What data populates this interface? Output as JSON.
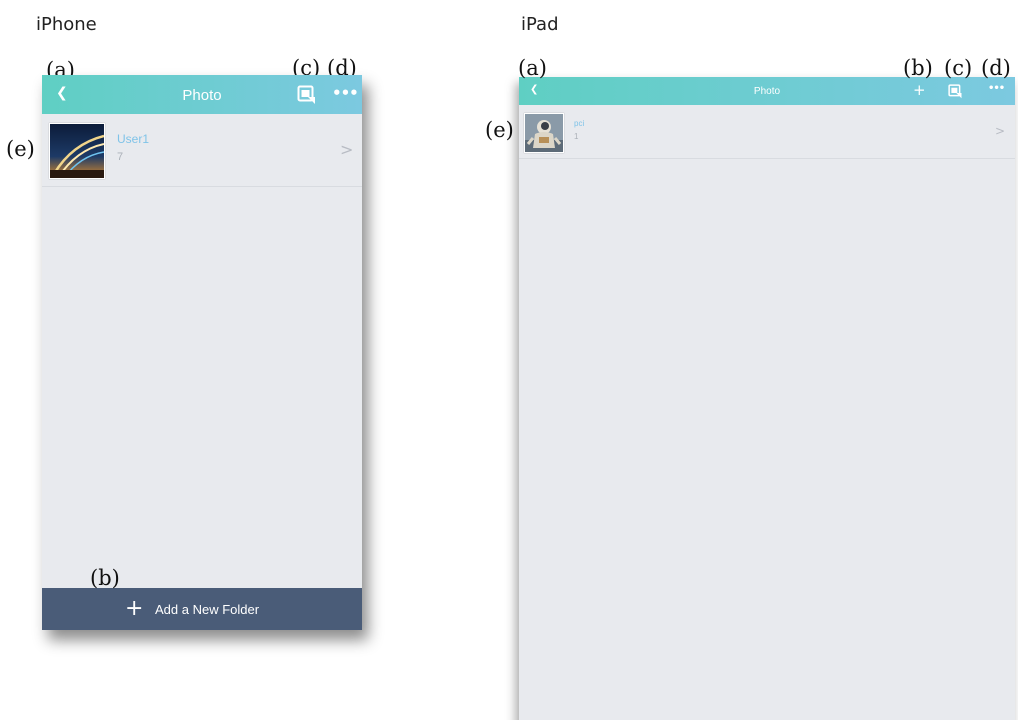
{
  "labels": {
    "iphone": "iPhone",
    "ipad": "iPad"
  },
  "callouts": {
    "a": "(a)",
    "b": "(b)",
    "c": "(c)",
    "d": "(d)",
    "e": "(e)"
  },
  "iphone": {
    "nav": {
      "back_icon": "chevron-left-icon",
      "title": "Photo",
      "share_icon": "share-photo-icon",
      "more_icon": "ellipsis-icon"
    },
    "folders": [
      {
        "name": "User1",
        "count": "7",
        "chevron": ">"
      }
    ],
    "bottom_bar": {
      "icon": "plus-icon",
      "label": "Add a New Folder"
    }
  },
  "ipad": {
    "nav": {
      "back_icon": "chevron-left-icon",
      "title": "Photo",
      "add_icon": "plus-icon",
      "share_icon": "share-photo-icon",
      "more_icon": "ellipsis-icon"
    },
    "folders": [
      {
        "name": "pci",
        "count": "1",
        "chevron": ">"
      }
    ]
  },
  "colors": {
    "navbar_start": "#5fcfc3",
    "navbar_end": "#7cc9e0",
    "background": "#e8eaee",
    "bottom_bar": "#4a5c78",
    "folder_name": "#7fc3e8"
  }
}
